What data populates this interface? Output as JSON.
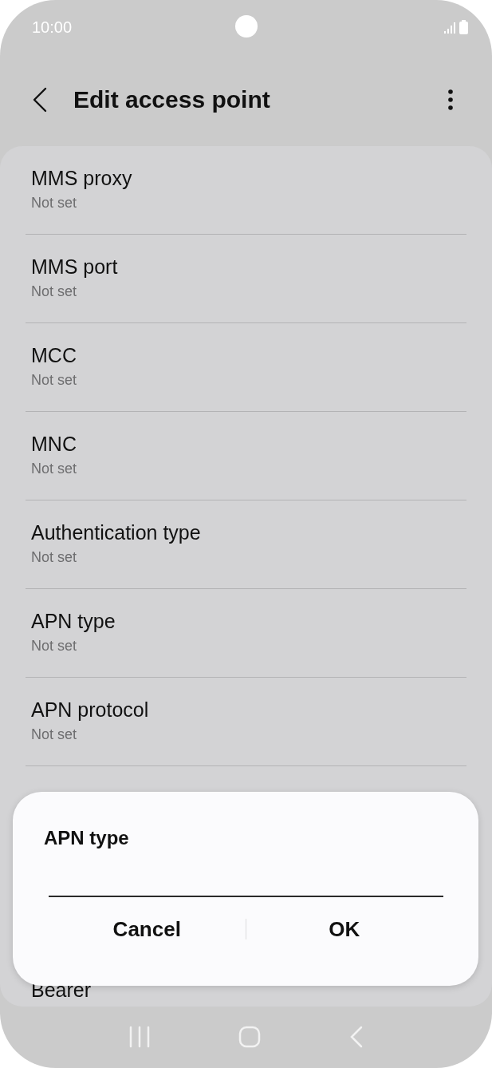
{
  "status_bar": {
    "time": "10:00"
  },
  "header": {
    "title": "Edit access point"
  },
  "settings": [
    {
      "title": "MMS proxy",
      "value": "Not set"
    },
    {
      "title": "MMS port",
      "value": "Not set"
    },
    {
      "title": "MCC",
      "value": "Not set"
    },
    {
      "title": "MNC",
      "value": "Not set"
    },
    {
      "title": "Authentication type",
      "value": "Not set"
    },
    {
      "title": "APN type",
      "value": "Not set"
    },
    {
      "title": "APN protocol",
      "value": "Not set"
    }
  ],
  "partial_item": {
    "title": "Bearer"
  },
  "dialog": {
    "title": "APN type",
    "buttons": [
      "Cancel",
      "OK"
    ]
  }
}
